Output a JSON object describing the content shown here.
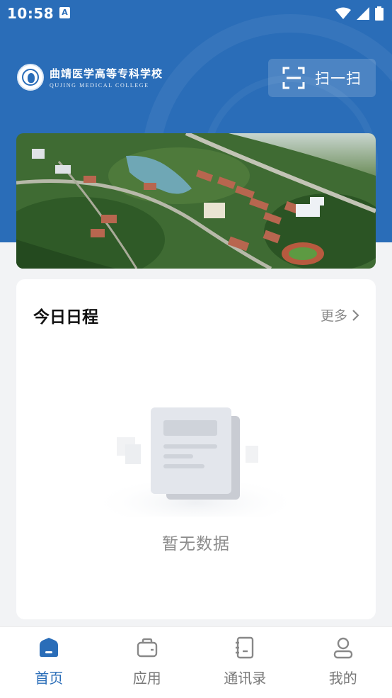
{
  "status_bar": {
    "time": "10:58",
    "notification_icon": "a-icon",
    "icons": [
      "wifi-icon",
      "signal-icon",
      "battery-icon"
    ]
  },
  "header": {
    "logo": {
      "name_cn": "曲靖医学高等专科学校",
      "name_en": "QUJING MEDICAL COLLEGE"
    },
    "scan_button": {
      "label": "扫一扫",
      "icon": "scan-icon"
    }
  },
  "banner": {
    "description_icon": "campus-aerial-photo"
  },
  "schedule": {
    "title": "今日日程",
    "more_label": "更多",
    "empty_text": "暂无数据"
  },
  "tabbar": {
    "items": [
      {
        "label": "首页",
        "icon": "home-icon",
        "active": true
      },
      {
        "label": "应用",
        "icon": "briefcase-icon",
        "active": false
      },
      {
        "label": "通讯录",
        "icon": "contacts-icon",
        "active": false
      },
      {
        "label": "我的",
        "icon": "user-icon",
        "active": false
      }
    ]
  },
  "colors": {
    "brand_blue": "#2a6db8",
    "background": "#f2f3f5",
    "inactive_gray": "#777777"
  }
}
